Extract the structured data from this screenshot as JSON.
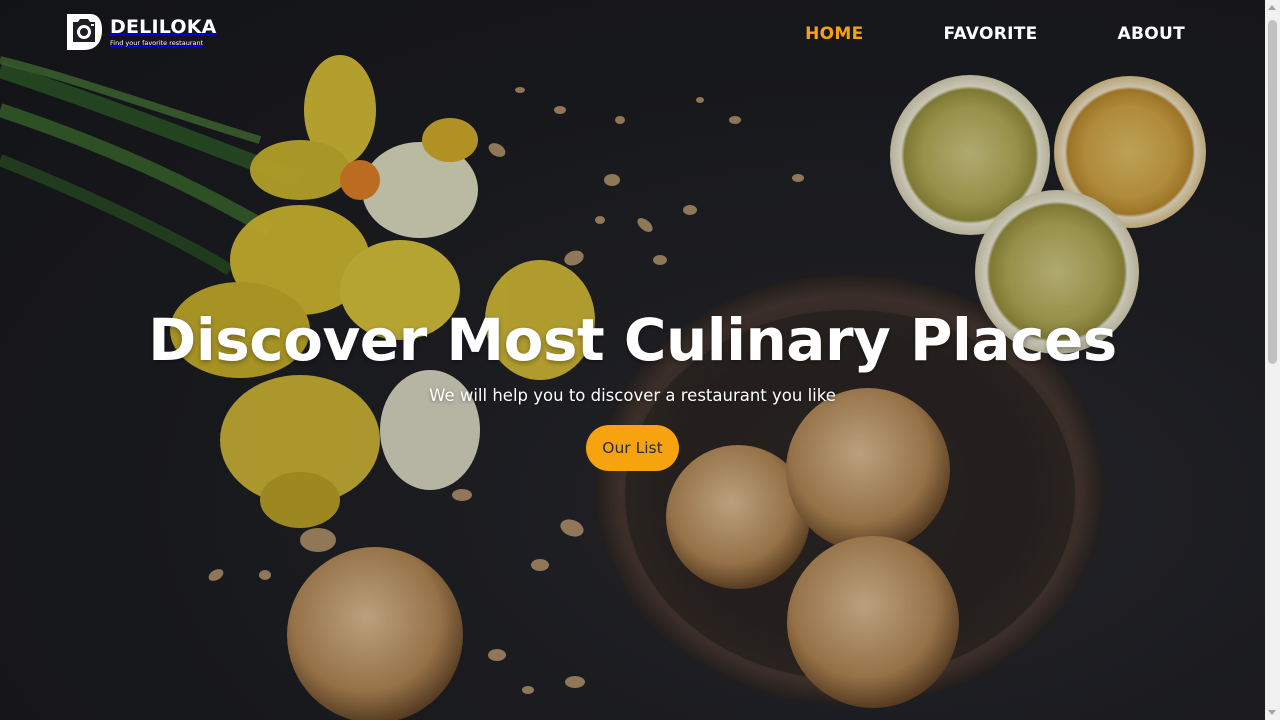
{
  "brand": {
    "name": "DELILOKA",
    "tagline": "Find your favorite restaurant",
    "logo_icon": "camera-logo-icon"
  },
  "nav": {
    "items": [
      {
        "label": "HOME",
        "active": true
      },
      {
        "label": "FAVORITE",
        "active": false
      },
      {
        "label": "ABOUT",
        "active": false
      }
    ]
  },
  "hero": {
    "title": "Discover Most Culinary Places",
    "subtitle": "We will help you to discover a restaurant you like",
    "cta_label": "Our List",
    "background": "dark-food-photo"
  },
  "colors": {
    "accent": "#f7a20f",
    "text": "#ffffff",
    "background": "#1e1f24"
  }
}
